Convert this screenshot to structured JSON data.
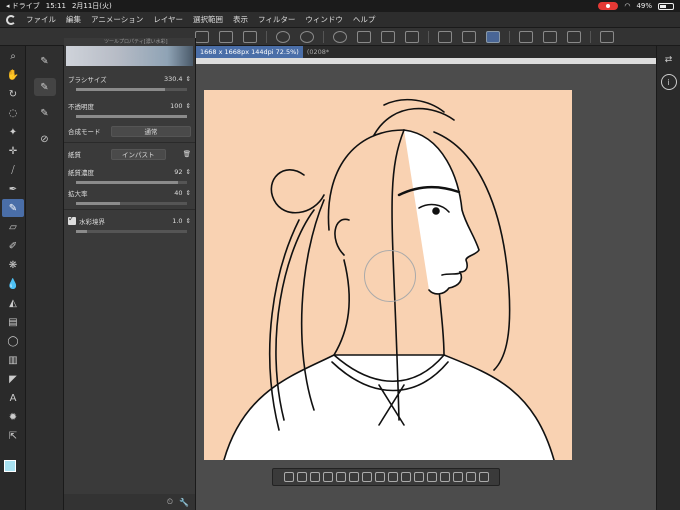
{
  "status_bar": {
    "app_back": "◂ ドライブ",
    "time": "15:11",
    "date": "2月11日(火)",
    "battery": "49%",
    "battery_level": 0.49
  },
  "menu": [
    "ファイル",
    "編集",
    "アニメーション",
    "レイヤー",
    "選択範囲",
    "表示",
    "フィルター",
    "ウィンドウ",
    "ヘルプ"
  ],
  "tool_property": {
    "panel_title": "ツールプロパティ[濃い水彩]",
    "header_label": "濃い水彩",
    "brush_size_label": "ブラシサイズ",
    "brush_size_value": "330.4",
    "opacity_label": "不透明度",
    "opacity_value": "100",
    "blend_mode_label": "合成モード",
    "blend_mode_value": "通常",
    "paper_label": "紙質",
    "paper_value": "インパスト",
    "paper_density_label": "紙質濃度",
    "paper_density_value": "92",
    "scale_label": "拡大率",
    "scale_value": "40",
    "watercolor_edge_label": "水彩境界",
    "watercolor_edge_value": "1.0"
  },
  "document": {
    "tab_active": "1668 x 1668px 144dpi 72.5%)",
    "tab_inactive": "(0208*"
  }
}
